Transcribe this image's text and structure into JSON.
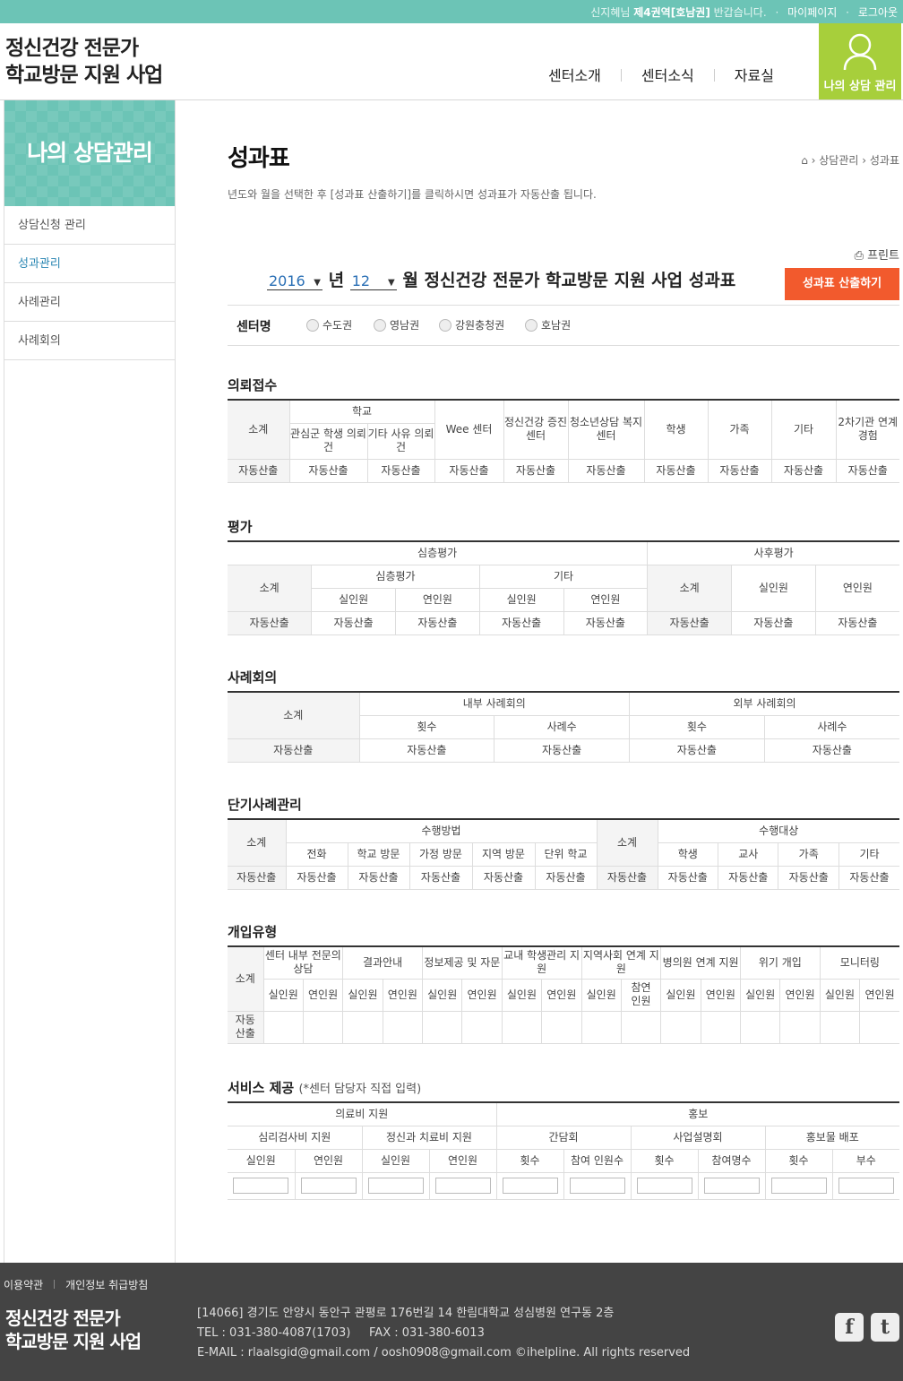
{
  "topbar": {
    "greeting_pre": "신지혜님",
    "region": "제4권역[호남권]",
    "greeting_post": "반갑습니다.",
    "mypage": "마이페이지",
    "logout": "로그아웃"
  },
  "header": {
    "logo_line1": "정신건강 전문가",
    "logo_line2": "학교방문 지원 사업",
    "nav": [
      "센터소개",
      "센터소식",
      "자료실"
    ],
    "my_button": "나의 상담 관리"
  },
  "sidebar": {
    "title": "나의 상담관리",
    "items": [
      {
        "label": "상담신청 관리"
      },
      {
        "label": "성과관리"
      },
      {
        "label": "사례관리"
      },
      {
        "label": "사례회의"
      }
    ],
    "active_color": "#2b87b3"
  },
  "page": {
    "title": "성과표",
    "breadcrumb": [
      "상담관리",
      "성과표"
    ],
    "description": "년도와 월을 선택한 후 [성과표 산출하기]를 클릭하시면 성과표가 자동산출 됩니다.",
    "print": "프린트",
    "year": "2016",
    "year_unit": "년",
    "month": "12",
    "month_unit": "월",
    "sheet_title": "정신건강 전문가 학교방문 지원 사업 성과표",
    "calc_button": "성과표 산출하기",
    "center_label": "센터명",
    "centers": [
      "수도권",
      "영남권",
      "강원충청권",
      "호남권"
    ]
  },
  "auto": "자동산출",
  "auto_short": [
    "자동",
    "산출"
  ],
  "sections": {
    "referral": {
      "title": "의뢰접수",
      "subtotal": "소계",
      "school": "학교",
      "school_sub": [
        "관심군 학생 의뢰건",
        "기타 사유 의뢰건"
      ],
      "cols": [
        "Wee 센터",
        "정신건강 증진센터",
        "청소년상담 복지센터",
        "학생",
        "가족",
        "기타",
        "2차기관 연계경험"
      ]
    },
    "evaluation": {
      "title": "평가",
      "deep": "심층평가",
      "deep_sub": [
        "심층평가",
        "기타"
      ],
      "post": "사후평가",
      "subtotal": "소계",
      "real": "실인원",
      "cum": "연인원"
    },
    "case_meeting": {
      "title": "사례회의",
      "subtotal": "소계",
      "internal": "내부 사례회의",
      "external": "외부 사례회의",
      "count": "횟수",
      "cases": "사례수"
    },
    "short_case": {
      "title": "단기사례관리",
      "subtotal": "소계",
      "method": "수행방법",
      "methods": [
        "전화",
        "학교 방문",
        "가정 방문",
        "지역 방문",
        "단위 학교"
      ],
      "target": "수행대상",
      "targets": [
        "학생",
        "교사",
        "가족",
        "기타"
      ]
    },
    "intervention": {
      "title": "개입유형",
      "subtotal": "소계",
      "types": [
        "센터 내부 전문의 상담",
        "결과안내",
        "정보제공 및 자문",
        "교내 학생관리 지원",
        "지역사회 연계 지원",
        "병의원 연계 지원",
        "위기 개입",
        "모니터링"
      ],
      "real": "실인원",
      "cum": "연인원",
      "cum_alt": [
        "참연",
        "인원"
      ]
    },
    "service": {
      "title": "서비스 제공",
      "note": "(*센터 담당자 직접 입력)",
      "medical": "의료비 지원",
      "medical_sub": [
        "심리검사비 지원",
        "정신과 치료비 지원"
      ],
      "promo": "홍보",
      "promo_sub": [
        "간담회",
        "사업설명회",
        "홍보물 배포"
      ],
      "leaf": [
        "실인원",
        "연인원",
        "실인원",
        "연인원",
        "횟수",
        "참여 인원수",
        "횟수",
        "참여명수",
        "횟수",
        "부수"
      ]
    }
  },
  "footer": {
    "links": [
      "이용약관",
      "개인정보 취급방침"
    ],
    "logo_line1": "정신건강 전문가",
    "logo_line2": "학교방문 지원 사업",
    "address": "[14066] 경기도 안양시 동안구 관평로 176번길 14 한림대학교 성심병원 연구동 2층",
    "tel": "TEL : 031-380-4087(1703)     FAX : 031-380-6013",
    "email": "E-MAIL : rlaalsgid@gmail.com / oosh0908@gmail.com ©ihelpline. All rights reserved",
    "facebook": "f",
    "twitter": "t"
  },
  "colors": {
    "topbar": "#6cc4b6",
    "my_button": "#a7cf3b",
    "calc_button": "#f25a2d",
    "footer": "#444444"
  }
}
